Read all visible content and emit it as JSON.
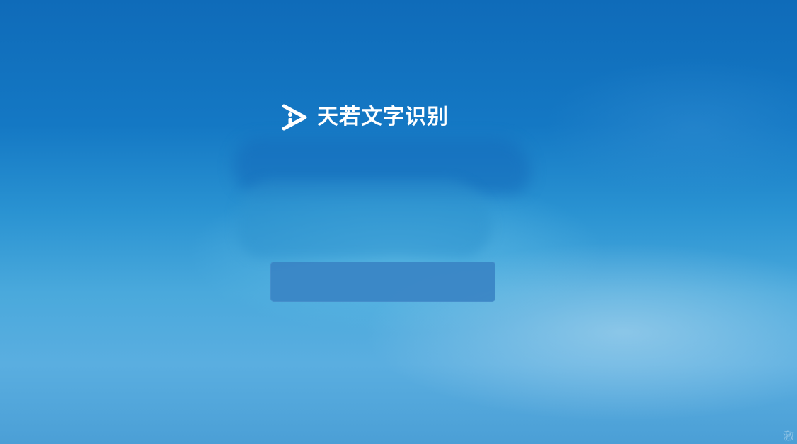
{
  "app": {
    "title": "天若文字识别",
    "logo_icon": "play-i-logo-icon"
  },
  "start_button": {
    "label": ""
  },
  "corner": {
    "text": "激"
  },
  "colors": {
    "background_top": "#0f6bb9",
    "background_bottom": "#4b9fd6",
    "button_fill": "#3a84c4",
    "title_text": "#ffffff"
  }
}
